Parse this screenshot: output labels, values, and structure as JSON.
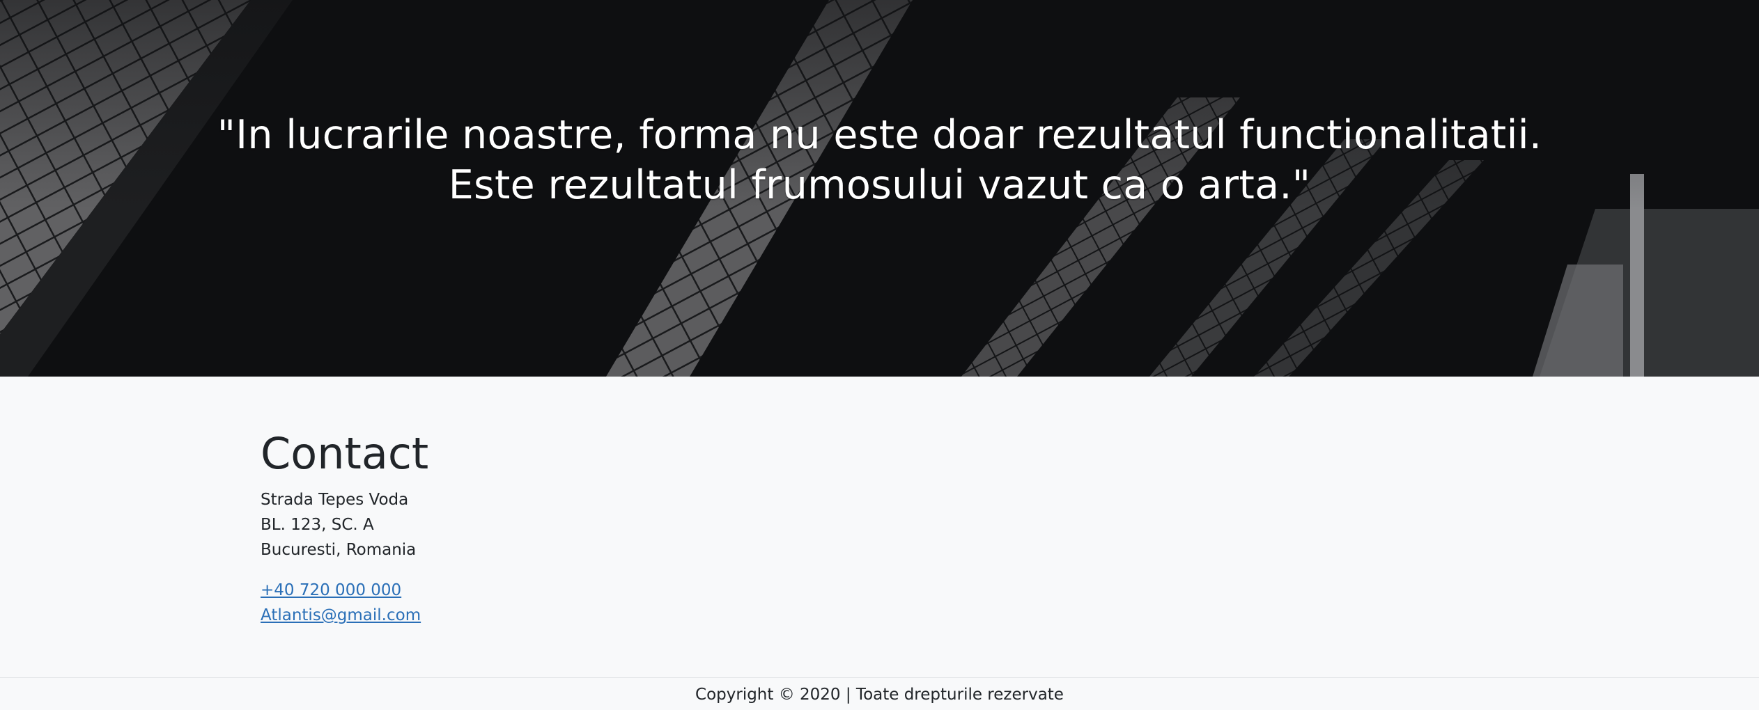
{
  "hero": {
    "quote_line1": "\"In lucrarile noastre, forma nu este doar rezultatul functionalitatii.",
    "quote_line2": "Este rezultatul frumosului vazut ca o arta.\""
  },
  "contact": {
    "title": "Contact",
    "address": [
      "Strada Tepes Voda",
      "BL. 123, SC. A",
      "Bucuresti, Romania"
    ],
    "phone": "+40 720 000 000",
    "email": "Atlantis@gmail.com",
    "link_color": "#2a6fb7"
  },
  "footer": {
    "copyright": "Copyright © 2020 | Toate drepturile rezervate"
  }
}
